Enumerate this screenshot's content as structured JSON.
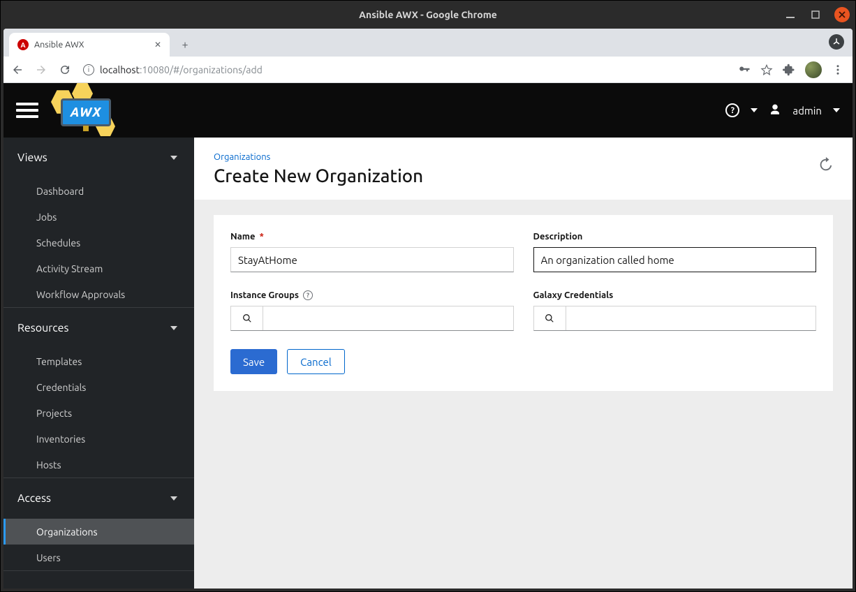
{
  "os": {
    "title": "Ansible AWX - Google Chrome"
  },
  "browser": {
    "tab_title": "Ansible AWX",
    "url_host": "localhost",
    "url_port_path": ":10080/#/organizations/add"
  },
  "header": {
    "logo_text": "AWX",
    "username": "admin"
  },
  "sidebar": {
    "sections": [
      {
        "title": "Views",
        "items": [
          "Dashboard",
          "Jobs",
          "Schedules",
          "Activity Stream",
          "Workflow Approvals"
        ]
      },
      {
        "title": "Resources",
        "items": [
          "Templates",
          "Credentials",
          "Projects",
          "Inventories",
          "Hosts"
        ]
      },
      {
        "title": "Access",
        "items": [
          "Organizations",
          "Users"
        ]
      }
    ],
    "active": "Organizations"
  },
  "page": {
    "breadcrumb": "Organizations",
    "title": "Create New Organization"
  },
  "form": {
    "name_label": "Name",
    "name_value": "StayAtHome",
    "description_label": "Description",
    "description_value": "An organization called home",
    "instance_groups_label": "Instance Groups",
    "galaxy_credentials_label": "Galaxy Credentials",
    "save_label": "Save",
    "cancel_label": "Cancel"
  }
}
